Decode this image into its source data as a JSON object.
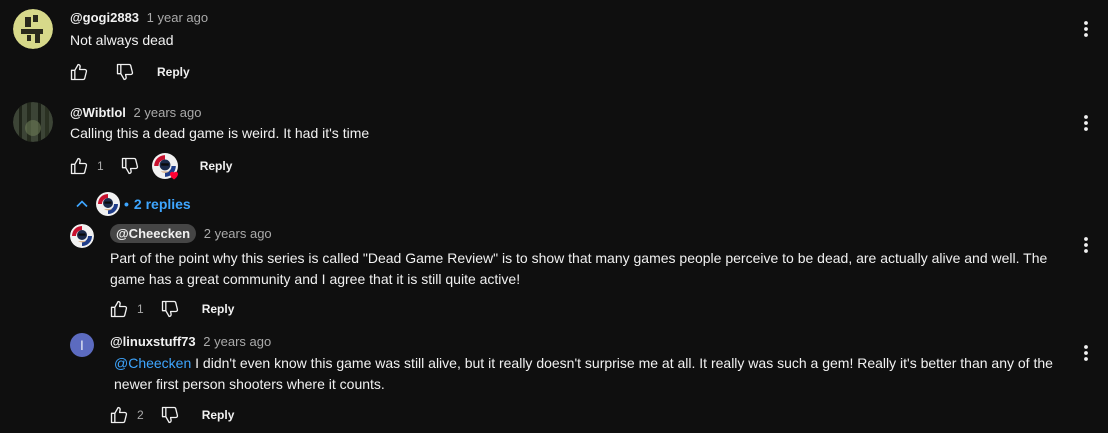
{
  "colors": {
    "background": "#0f0f0f",
    "text": "#f1f1f1",
    "muted": "#aaaaaa",
    "link": "#3ea6ff",
    "heart": "#ff0033"
  },
  "comments": [
    {
      "author": "@gogi2883",
      "time": "1 year ago",
      "text": "Not always dead",
      "likes": "",
      "reply_label": "Reply"
    },
    {
      "author": "@Wibtlol",
      "time": "2 years ago",
      "text": "Calling this a dead game is weird. It had it's time",
      "likes": "1",
      "reply_label": "Reply"
    }
  ],
  "replies_toggle": {
    "label": "2 replies"
  },
  "replies": [
    {
      "author": "@Cheecken",
      "time": "2 years ago",
      "text_line1": "Part of the point why this series is called \"Dead Game Review\" is to show that many games people perceive to be dead, are actually alive and well. The",
      "text_line2": "game has a great community and I agree that it is still quite active!",
      "likes": "1",
      "reply_label": "Reply"
    },
    {
      "author": "@linuxstuff73",
      "avatar_letter": "l",
      "time": "2 years ago",
      "mention": "@Cheecken",
      "text_line1": " I didn't even know this game was still alive, but it really doesn't surprise me at all. It really was such a gem! Really it's better than any of the",
      "text_line2": "newer first person shooters where it counts.",
      "likes": "2",
      "reply_label": "Reply"
    }
  ],
  "icons": [
    "thumbs-up-icon",
    "thumbs-down-icon",
    "more-vert-icon",
    "chevron-up-icon",
    "heart-icon"
  ]
}
